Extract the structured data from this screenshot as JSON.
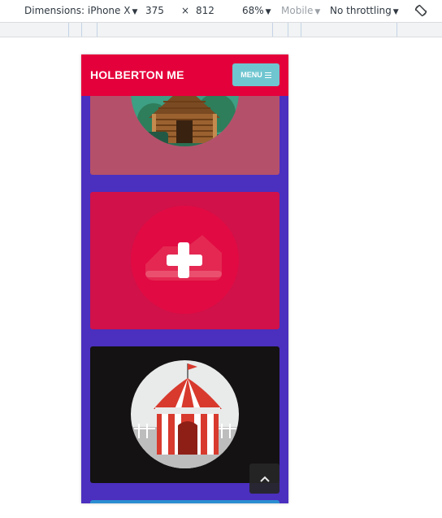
{
  "devtools": {
    "device_label": "Dimensions: iPhone X",
    "width_value": "375",
    "times_sign": "×",
    "height_value": "812",
    "zoom": "68%",
    "mode": "Mobile",
    "throttling": "No throttling"
  },
  "site": {
    "brand": "HOLBERTON ME",
    "menu_label": "MENU",
    "colors": {
      "header": "#e4003b",
      "menu_button": "#6fc6d0",
      "background": "#4b2fbf"
    }
  },
  "cards": [
    {
      "icon": "log-cabin-icon",
      "color": "#b5506a"
    },
    {
      "icon": "plus-icon",
      "color": "#d0114a"
    },
    {
      "icon": "circus-tent-icon",
      "color": "#141212"
    },
    {
      "icon": "",
      "color": "#2a8dd0"
    }
  ],
  "scroll_top_icon": "chevron-up-icon"
}
